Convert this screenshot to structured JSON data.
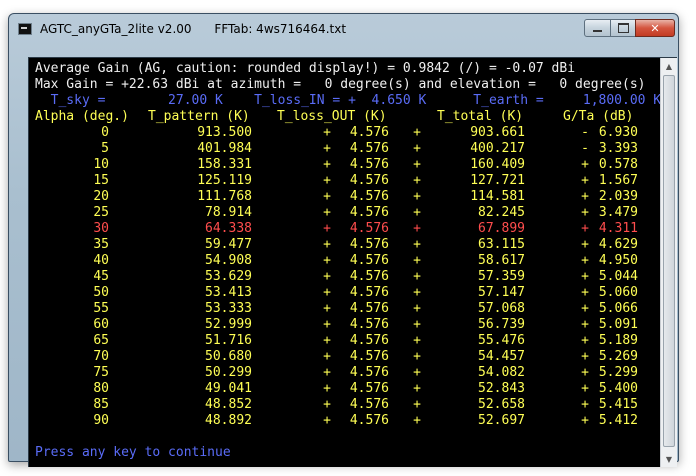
{
  "window": {
    "title": "AGTC_anyGTa_2lite v2.00      FFTab: 4ws716464.txt",
    "min_glyph": "",
    "max_glyph": "",
    "close_glyph": "✕"
  },
  "console": {
    "line1": "Average Gain (AG, caution: rounded display!) = 0.9842 (/) = -0.07 dBi",
    "line2": "Max Gain = +22.63 dBi at azimuth =   0 degree(s) and elevation =   0 degree(s)",
    "line3": "  T_sky =        27.00 K    T_loss_IN = +  4.650 K      T_earth =     1,800.00 K",
    "header": {
      "alpha": "Alpha (deg.)",
      "t_pattern": "T_pattern (K)",
      "t_loss_out": "T_loss_OUT (K)",
      "t_total": "T_total (K)",
      "g_ta": "G/Ta (dB)"
    },
    "rows": [
      {
        "alpha": "0",
        "t_pattern": "913.500",
        "plus1": "+",
        "t_loss_out": "4.576",
        "plus2": "+",
        "t_total": "903.661",
        "sign": "-",
        "g_ta": "6.930",
        "highlight": false
      },
      {
        "alpha": "5",
        "t_pattern": "401.984",
        "plus1": "+",
        "t_loss_out": "4.576",
        "plus2": "+",
        "t_total": "400.217",
        "sign": "-",
        "g_ta": "3.393",
        "highlight": false
      },
      {
        "alpha": "10",
        "t_pattern": "158.331",
        "plus1": "+",
        "t_loss_out": "4.576",
        "plus2": "+",
        "t_total": "160.409",
        "sign": "+",
        "g_ta": "0.578",
        "highlight": false
      },
      {
        "alpha": "15",
        "t_pattern": "125.119",
        "plus1": "+",
        "t_loss_out": "4.576",
        "plus2": "+",
        "t_total": "127.721",
        "sign": "+",
        "g_ta": "1.567",
        "highlight": false
      },
      {
        "alpha": "20",
        "t_pattern": "111.768",
        "plus1": "+",
        "t_loss_out": "4.576",
        "plus2": "+",
        "t_total": "114.581",
        "sign": "+",
        "g_ta": "2.039",
        "highlight": false
      },
      {
        "alpha": "25",
        "t_pattern": "78.914",
        "plus1": "+",
        "t_loss_out": "4.576",
        "plus2": "+",
        "t_total": "82.245",
        "sign": "+",
        "g_ta": "3.479",
        "highlight": false
      },
      {
        "alpha": "30",
        "t_pattern": "64.338",
        "plus1": "+",
        "t_loss_out": "4.576",
        "plus2": "+",
        "t_total": "67.899",
        "sign": "+",
        "g_ta": "4.311",
        "highlight": true
      },
      {
        "alpha": "35",
        "t_pattern": "59.477",
        "plus1": "+",
        "t_loss_out": "4.576",
        "plus2": "+",
        "t_total": "63.115",
        "sign": "+",
        "g_ta": "4.629",
        "highlight": false
      },
      {
        "alpha": "40",
        "t_pattern": "54.908",
        "plus1": "+",
        "t_loss_out": "4.576",
        "plus2": "+",
        "t_total": "58.617",
        "sign": "+",
        "g_ta": "4.950",
        "highlight": false
      },
      {
        "alpha": "45",
        "t_pattern": "53.629",
        "plus1": "+",
        "t_loss_out": "4.576",
        "plus2": "+",
        "t_total": "57.359",
        "sign": "+",
        "g_ta": "5.044",
        "highlight": false
      },
      {
        "alpha": "50",
        "t_pattern": "53.413",
        "plus1": "+",
        "t_loss_out": "4.576",
        "plus2": "+",
        "t_total": "57.147",
        "sign": "+",
        "g_ta": "5.060",
        "highlight": false
      },
      {
        "alpha": "55",
        "t_pattern": "53.333",
        "plus1": "+",
        "t_loss_out": "4.576",
        "plus2": "+",
        "t_total": "57.068",
        "sign": "+",
        "g_ta": "5.066",
        "highlight": false
      },
      {
        "alpha": "60",
        "t_pattern": "52.999",
        "plus1": "+",
        "t_loss_out": "4.576",
        "plus2": "+",
        "t_total": "56.739",
        "sign": "+",
        "g_ta": "5.091",
        "highlight": false
      },
      {
        "alpha": "65",
        "t_pattern": "51.716",
        "plus1": "+",
        "t_loss_out": "4.576",
        "plus2": "+",
        "t_total": "55.476",
        "sign": "+",
        "g_ta": "5.189",
        "highlight": false
      },
      {
        "alpha": "70",
        "t_pattern": "50.680",
        "plus1": "+",
        "t_loss_out": "4.576",
        "plus2": "+",
        "t_total": "54.457",
        "sign": "+",
        "g_ta": "5.269",
        "highlight": false
      },
      {
        "alpha": "75",
        "t_pattern": "50.299",
        "plus1": "+",
        "t_loss_out": "4.576",
        "plus2": "+",
        "t_total": "54.082",
        "sign": "+",
        "g_ta": "5.299",
        "highlight": false
      },
      {
        "alpha": "80",
        "t_pattern": "49.041",
        "plus1": "+",
        "t_loss_out": "4.576",
        "plus2": "+",
        "t_total": "52.843",
        "sign": "+",
        "g_ta": "5.400",
        "highlight": false
      },
      {
        "alpha": "85",
        "t_pattern": "48.852",
        "plus1": "+",
        "t_loss_out": "4.576",
        "plus2": "+",
        "t_total": "52.658",
        "sign": "+",
        "g_ta": "5.415",
        "highlight": false
      },
      {
        "alpha": "90",
        "t_pattern": "48.892",
        "plus1": "+",
        "t_loss_out": "4.576",
        "plus2": "+",
        "t_total": "52.697",
        "sign": "+",
        "g_ta": "5.412",
        "highlight": false
      }
    ],
    "prompt": "Press any key to continue"
  },
  "colors": {
    "console_bg": "#000000",
    "text_white": "#f0f0f0",
    "text_blue": "#5a6cf7",
    "text_yellow": "#ffff55",
    "text_red": "#ff4d4d"
  },
  "icons": {
    "app": "console-app-icon",
    "minimize": "minimize-icon",
    "maximize": "maximize-icon",
    "close": "close-icon"
  }
}
